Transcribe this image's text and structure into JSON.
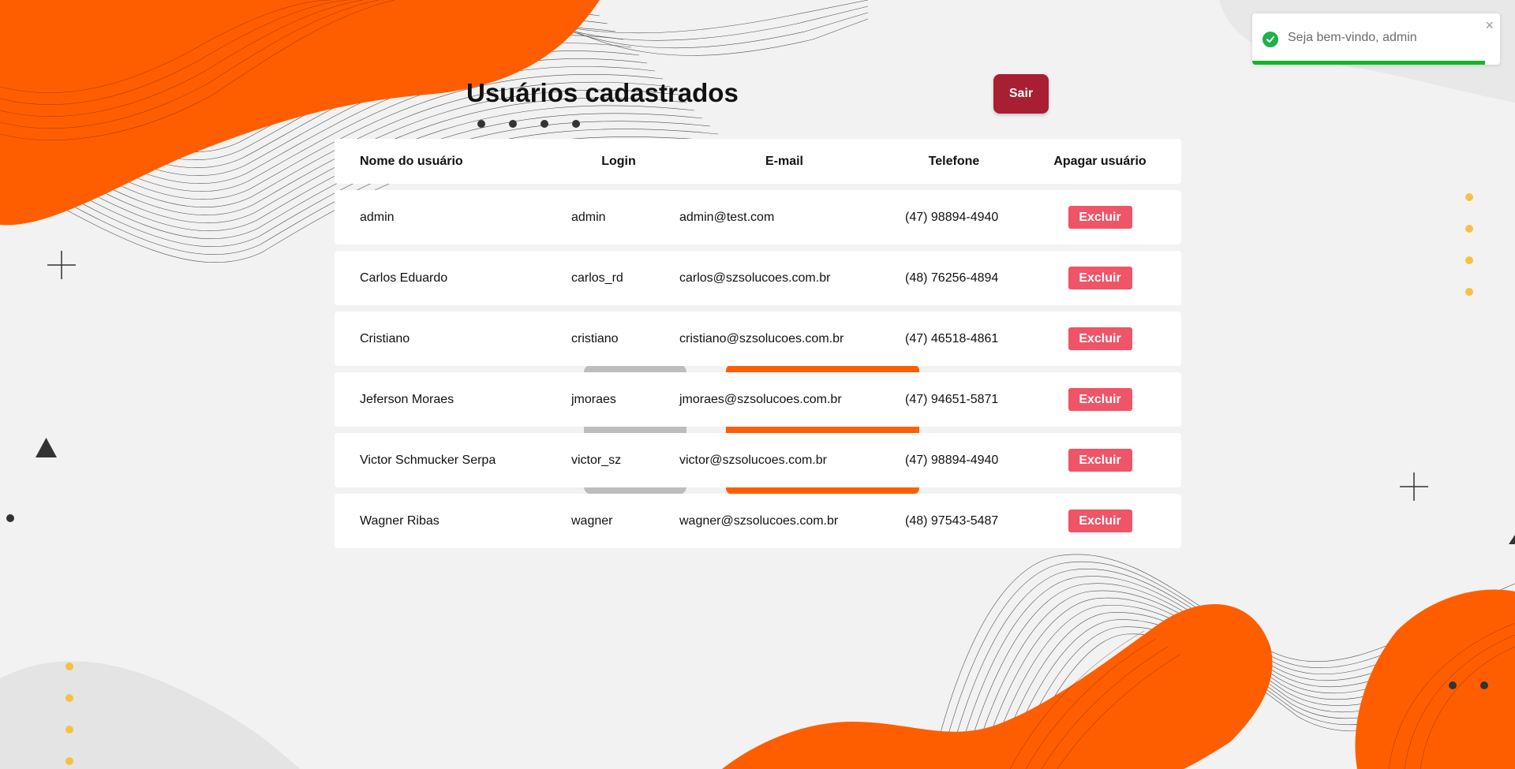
{
  "page": {
    "title": "Usuários cadastrados",
    "logout_label": "Sair"
  },
  "table": {
    "headers": {
      "name": "Nome do usuário",
      "login": "Login",
      "email": "E-mail",
      "phone": "Telefone",
      "action": "Apagar usuário"
    },
    "rows": [
      {
        "name": "admin",
        "login": "admin",
        "email": "admin@test.com",
        "phone": "(47) 98894-4940",
        "action": "Excluir"
      },
      {
        "name": "Carlos Eduardo",
        "login": "carlos_rd",
        "email": "carlos@szsolucoes.com.br",
        "phone": "(48) 76256-4894",
        "action": "Excluir"
      },
      {
        "name": "Cristiano",
        "login": "cristiano",
        "email": "cristiano@szsolucoes.com.br",
        "phone": "(47) 46518-4861",
        "action": "Excluir"
      },
      {
        "name": "Jeferson Moraes",
        "login": "jmoraes",
        "email": "jmoraes@szsolucoes.com.br",
        "phone": "(47) 94651-5871",
        "action": "Excluir"
      },
      {
        "name": "Victor Schmucker Serpa",
        "login": "victor_sz",
        "email": "victor@szsolucoes.com.br",
        "phone": "(47) 98894-4940",
        "action": "Excluir"
      },
      {
        "name": "Wagner Ribas",
        "login": "wagner",
        "email": "wagner@szsolucoes.com.br",
        "phone": "(48) 97543-5487",
        "action": "Excluir"
      }
    ]
  },
  "toast": {
    "message": "Seja bem-vindo, admin",
    "icon": "check-circle-icon",
    "close_icon": "close-icon",
    "progress": 0.94
  },
  "colors": {
    "background": "#f2f2f2",
    "accent_orange": "#ff5e00",
    "logout_button": "#a81e32",
    "delete_button": "#ef5467",
    "toast_success": "#11b52a",
    "dot_yellow": "#f7c045"
  }
}
